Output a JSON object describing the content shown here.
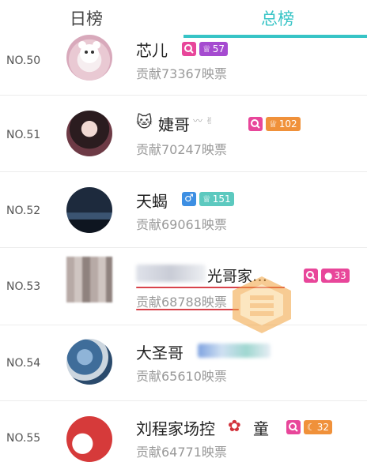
{
  "tabs": {
    "daily": "日榜",
    "total": "总榜",
    "active": "总榜"
  },
  "colors": {
    "accent": "#37c4c6",
    "badge_pink": "#e8469a",
    "badge_purple": "#a54bd0",
    "badge_orange": "#f0913a",
    "badge_teal": "#5cc9bf",
    "badge_blue": "#3d8fe3"
  },
  "rows": [
    {
      "rank": "NO.50",
      "name": "芯儿",
      "contribution": "贡献73367映票",
      "level": "57",
      "level_icon": "crown-icon"
    },
    {
      "rank": "NO.51",
      "name": "婕哥",
      "contribution": "贡献70247映票",
      "level": "102",
      "level_icon": "crown-icon"
    },
    {
      "rank": "NO.52",
      "name": "天蝎",
      "contribution": "贡献69061映票",
      "level": "151",
      "level_icon": "crown-icon",
      "gender": "♂"
    },
    {
      "rank": "NO.53",
      "name": "光哥家…",
      "contribution": "贡献68788映票",
      "level": "33",
      "level_icon": "circle-icon"
    },
    {
      "rank": "NO.54",
      "name": "大圣哥",
      "contribution": "贡献65610映票"
    },
    {
      "rank": "NO.55",
      "name": "刘程家场控",
      "name_suffix": "童",
      "contribution": "贡献64771映票",
      "level": "32",
      "level_icon": "moon-icon"
    }
  ]
}
